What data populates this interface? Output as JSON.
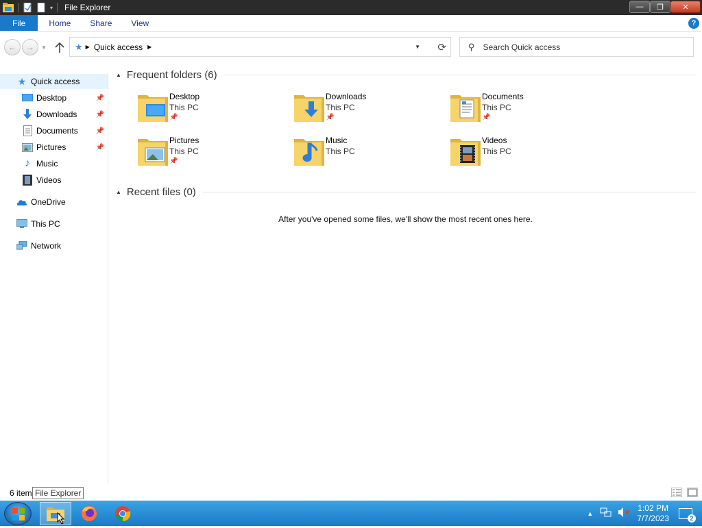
{
  "window": {
    "title": "File Explorer",
    "controls": {
      "minimize": "—",
      "restore": "❐",
      "close": "✕"
    }
  },
  "ribbon": {
    "tabs": [
      "File",
      "Home",
      "Share",
      "View"
    ],
    "help": "?"
  },
  "address": {
    "crumb": "Quick access",
    "search_placeholder": "Search Quick access"
  },
  "nav_pane": {
    "quick_access": "Quick access",
    "pinned": [
      {
        "label": "Desktop",
        "icon": "desktop-icon",
        "pinned": true
      },
      {
        "label": "Downloads",
        "icon": "downloads-icon",
        "pinned": true
      },
      {
        "label": "Documents",
        "icon": "documents-icon",
        "pinned": true
      },
      {
        "label": "Pictures",
        "icon": "pictures-icon",
        "pinned": true
      },
      {
        "label": "Music",
        "icon": "music-icon",
        "pinned": false
      },
      {
        "label": "Videos",
        "icon": "videos-icon",
        "pinned": false
      }
    ],
    "onedrive": "OneDrive",
    "this_pc": "This PC",
    "network": "Network"
  },
  "content": {
    "frequent_header": "Frequent folders (6)",
    "folders": [
      {
        "name": "Desktop",
        "location": "This PC",
        "pinned": true,
        "icon": "desktop-folder-icon"
      },
      {
        "name": "Downloads",
        "location": "This PC",
        "pinned": true,
        "icon": "downloads-folder-icon"
      },
      {
        "name": "Documents",
        "location": "This PC",
        "pinned": true,
        "icon": "documents-folder-icon"
      },
      {
        "name": "Pictures",
        "location": "This PC",
        "pinned": true,
        "icon": "pictures-folder-icon"
      },
      {
        "name": "Music",
        "location": "This PC",
        "pinned": false,
        "icon": "music-folder-icon"
      },
      {
        "name": "Videos",
        "location": "This PC",
        "pinned": false,
        "icon": "videos-folder-icon"
      }
    ],
    "recent_header": "Recent files (0)",
    "recent_empty": "After you've opened some files, we'll show the most recent ones here."
  },
  "status": {
    "item_count": "6 item",
    "tooltip": "File Explorer"
  },
  "taskbar": {
    "apps": [
      "start-orb",
      "file-explorer",
      "firefox",
      "chrome"
    ],
    "time": "1:02 PM",
    "date": "7/7/2023",
    "notification_count": "2"
  },
  "colors": {
    "accent": "#1979ca",
    "folder_yellow": "#f0c94a",
    "taskbar": "#1a79c6",
    "selection": "#e5f3ff"
  }
}
